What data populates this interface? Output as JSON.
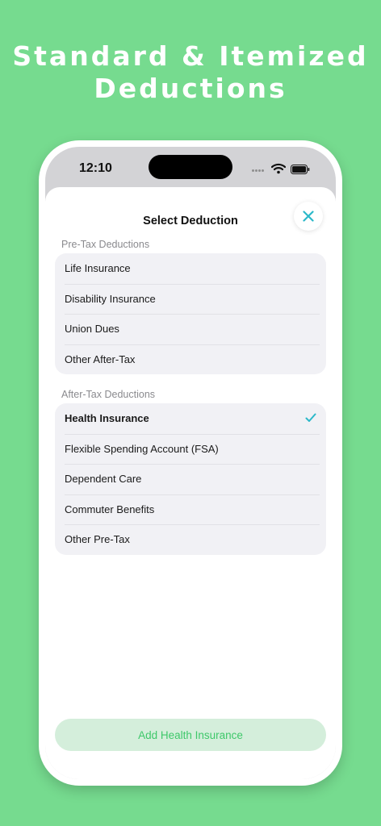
{
  "headline": {
    "line1": "Standard & Itemized",
    "line2": "Deductions"
  },
  "status_bar": {
    "time": "12:10"
  },
  "sheet": {
    "title": "Select Deduction",
    "pre_tax": {
      "header": "Pre-Tax Deductions",
      "items": [
        {
          "label": "Life Insurance"
        },
        {
          "label": "Disability Insurance"
        },
        {
          "label": "Union Dues"
        },
        {
          "label": "Other After-Tax"
        }
      ]
    },
    "after_tax": {
      "header": "After-Tax Deductions",
      "items": [
        {
          "label": "Health Insurance",
          "selected": true
        },
        {
          "label": "Flexible Spending Account (FSA)"
        },
        {
          "label": "Dependent Care"
        },
        {
          "label": "Commuter Benefits"
        },
        {
          "label": "Other Pre-Tax"
        }
      ]
    },
    "add_button_label": "Add Health Insurance"
  },
  "colors": {
    "background": "#76DB8F",
    "accent": "#2BB8C9",
    "button_fill": "#D4EEDB",
    "button_text": "#3EC86A"
  },
  "icons": {
    "close": "close-icon",
    "selected": "checkmark-icon",
    "wifi": "wifi-icon",
    "battery": "battery-icon"
  }
}
